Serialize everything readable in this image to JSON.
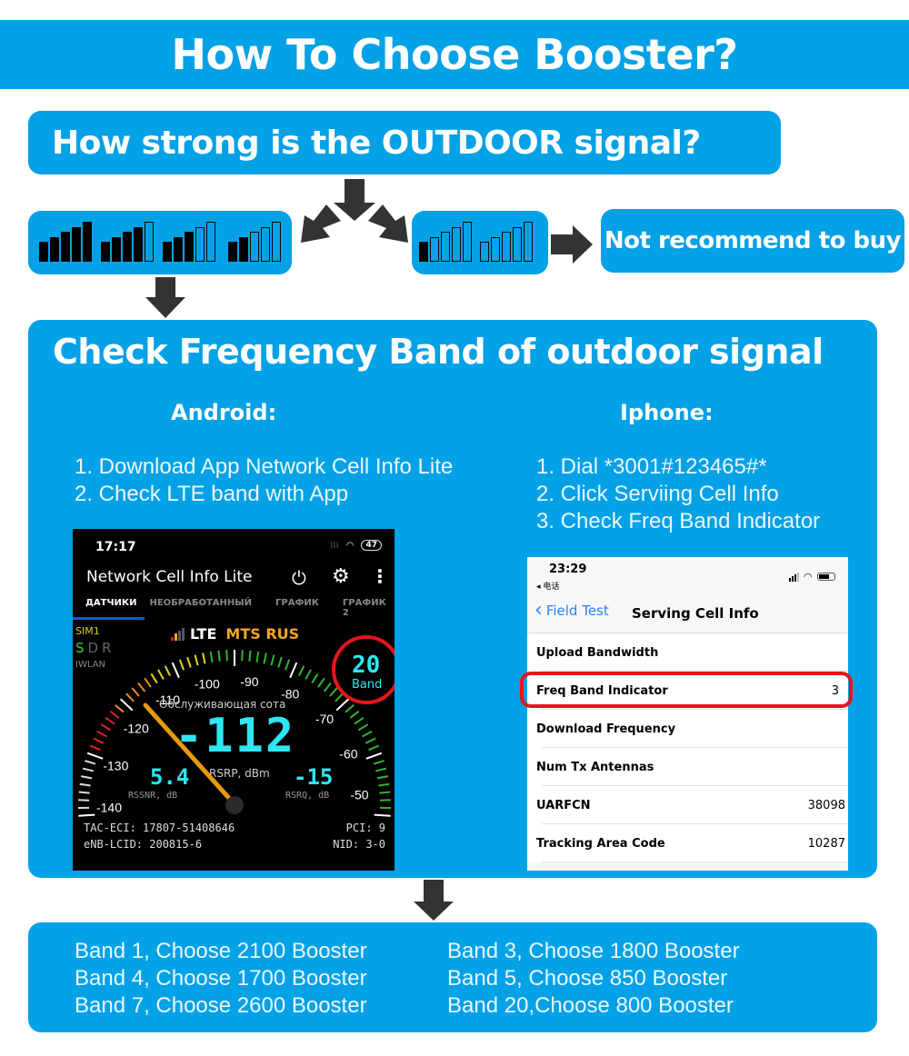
{
  "header": {
    "title": "How To Choose Booster?"
  },
  "question": {
    "text": "How strong is the OUTDOOR signal?"
  },
  "signal": {
    "strong_levels_on": [
      5,
      4,
      3,
      2
    ],
    "weak_levels_on": [
      1,
      0
    ],
    "bars_per_icon": 5
  },
  "not_recommend": {
    "text": "Not recommend to buy"
  },
  "check": {
    "title": "Check Frequency Band of outdoor signal",
    "android": {
      "heading": "Android:",
      "steps": [
        "1. Download App Network Cell Info Lite",
        "2. Check LTE band with App"
      ]
    },
    "iphone": {
      "heading": "Iphone:",
      "steps": [
        "1. Dial *3001#123465#*",
        "2. Click Serviing Cell Info",
        "3. Check Freq Band Indicator"
      ]
    }
  },
  "android_screen": {
    "time": "17:17",
    "battery": "47",
    "app_title": "Network Cell Info Lite",
    "tabs": [
      "ДАТЧИКИ",
      "НЕОБРАБОТАННЫЙ",
      "ГРАФИК",
      "ГРАФИК 2"
    ],
    "sim": "SIM1",
    "sdr": [
      "S",
      "D",
      "R"
    ],
    "iwlan": "IWLAN",
    "network": "LTE",
    "operator": "MTS RUS",
    "band_value": "20",
    "band_label": "Band",
    "gauge_ticks": [
      "-140",
      "-130",
      "-120",
      "-110",
      "-100",
      "-90",
      "-80",
      "-70",
      "-60",
      "-50"
    ],
    "serving_label": "Обслуживающая сота",
    "rsrp_value": "-112",
    "rsrp_label": "RSRP, dBm",
    "rssnr_value": "5.4",
    "rssnr_label": "RSSNR, dB",
    "rsrq_value": "-15",
    "rsrq_label": "RSRQ, dB",
    "tac_eci": "TAC-ECI: 17807-51408646",
    "enb_lcid": "eNB-LCID: 200815-6",
    "pci": "PCI: 9",
    "nid": "NID: 3-0"
  },
  "iphone_screen": {
    "time": "23:29",
    "back_app": "◂ 电话",
    "back_label": "Field Test",
    "nav_title": "Serving Cell Info",
    "rows": [
      {
        "label": "Upload Bandwidth",
        "value": ""
      },
      {
        "label": "Freq Band Indicator",
        "value": "3"
      },
      {
        "label": "Download Frequency",
        "value": ""
      },
      {
        "label": "Num Tx Antennas",
        "value": ""
      },
      {
        "label": "UARFCN",
        "value": "38098"
      },
      {
        "label": "Tracking Area Code",
        "value": "10287"
      }
    ]
  },
  "bands": {
    "left": [
      "Band 1, Choose 2100 Booster",
      "Band 4, Choose 1700 Booster",
      "Band 7, Choose 2600 Booster"
    ],
    "right": [
      "Band 3, Choose 1800 Booster",
      "Band 5, Choose 850 Booster",
      "Band 20,Choose 800 Booster"
    ]
  },
  "colors": {
    "brand_blue": "#03a1e6",
    "arrow": "#333333",
    "highlight_red": "#e8141b",
    "digit_cyan": "#2ee6f2",
    "operator_orange": "#f5a623"
  }
}
